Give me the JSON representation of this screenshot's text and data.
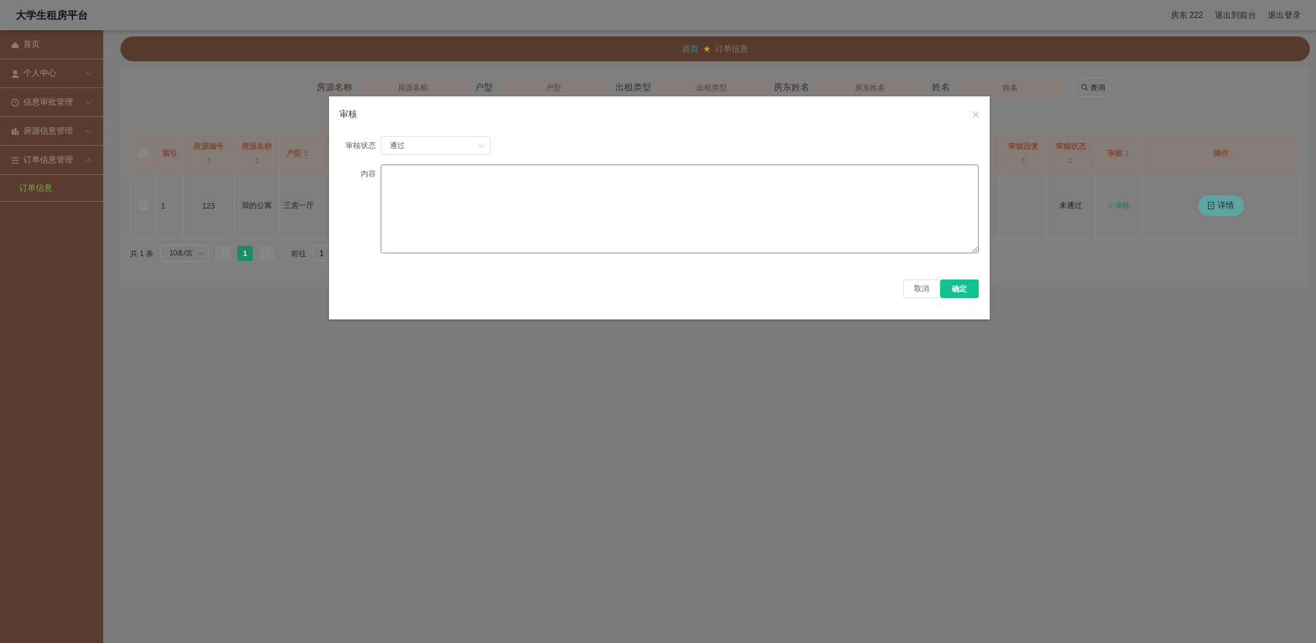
{
  "header": {
    "title": "大学生租房平台",
    "user": "房东 222",
    "links": [
      "退出到前台",
      "退出登录"
    ]
  },
  "sidebar": {
    "items": [
      {
        "label": "首页",
        "selected": false
      },
      {
        "label": "个人中心",
        "selected": false,
        "expanded": false
      },
      {
        "label": "信息审批管理",
        "selected": false,
        "expanded": false
      },
      {
        "label": "房源信息管理",
        "selected": false,
        "expanded": false
      },
      {
        "label": "订单信息管理",
        "selected": false,
        "expanded": true,
        "children": [
          {
            "label": "订单信息",
            "selected": true
          }
        ]
      }
    ]
  },
  "breadcrumb": [
    "首页",
    "订单信息"
  ],
  "search": {
    "fields": [
      {
        "label": "房源名称",
        "placeholder": "房源名称"
      },
      {
        "label": "户型",
        "placeholder": "户型"
      },
      {
        "label": "出租类型",
        "placeholder": "出租类型"
      },
      {
        "label": "房东姓名",
        "placeholder": "房东姓名"
      },
      {
        "label": "姓名",
        "placeholder": "姓名"
      }
    ],
    "button": "查询"
  },
  "table": {
    "select_all": {
      "checked": false
    },
    "columns": [
      {
        "label": "索引",
        "sortable": false
      },
      {
        "label": "房源编号",
        "sortable": true
      },
      {
        "label": "房源名称",
        "sortable": true
      },
      {
        "label": "户型",
        "sortable": true
      },
      {
        "label": "审核回复",
        "sortable": true
      },
      {
        "label": "审核状态",
        "sortable": true
      },
      {
        "label": "审核",
        "sortable": true
      },
      {
        "label": "操作",
        "sortable": false
      }
    ],
    "rows": [
      {
        "checked": false,
        "index": "1",
        "house_no": "123",
        "house_name": "我的公寓",
        "layout": "三房一厅",
        "audit_status": "未通过",
        "audit_link": "审核",
        "action": "详情"
      }
    ]
  },
  "pager": {
    "total": "共 1 条",
    "page_size": "10条/页",
    "pages": [
      {
        "label": "1",
        "selected": true
      }
    ],
    "goto_label": "前往",
    "goto_value": "1"
  },
  "dialog": {
    "title": "审核",
    "fields": [
      {
        "kind": "select",
        "label": "审核状态",
        "value": "通过"
      },
      {
        "kind": "textarea",
        "label": "内容",
        "focused": true
      }
    ],
    "buttons": [
      {
        "label": "取消",
        "kind": "default"
      },
      {
        "label": "确定",
        "kind": "primary"
      }
    ]
  }
}
